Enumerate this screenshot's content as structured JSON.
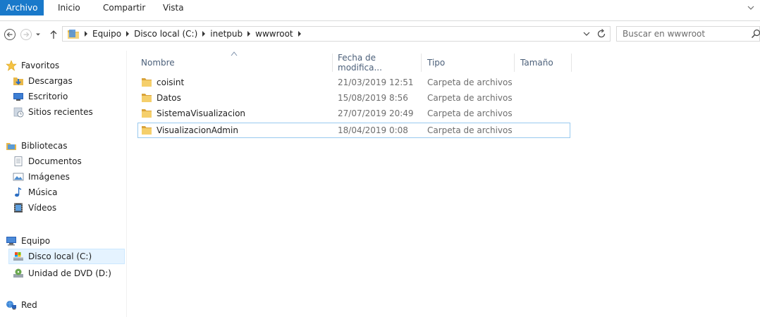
{
  "ribbon": {
    "tabs": [
      "Archivo",
      "Inicio",
      "Compartir",
      "Vista"
    ]
  },
  "address": {
    "crumbs": [
      "Equipo",
      "Disco local (C:)",
      "inetpub",
      "wwwroot"
    ]
  },
  "search": {
    "placeholder": "Buscar en wwwroot"
  },
  "sidebar": {
    "favorites": {
      "label": "Favoritos",
      "items": [
        "Descargas",
        "Escritorio",
        "Sitios recientes"
      ]
    },
    "libraries": {
      "label": "Bibliotecas",
      "items": [
        "Documentos",
        "Imágenes",
        "Música",
        "Vídeos"
      ]
    },
    "computer": {
      "label": "Equipo",
      "items": [
        "Disco local (C:)",
        "Unidad de DVD (D:)"
      ]
    },
    "network": {
      "label": "Red"
    },
    "selected": "Disco local (C:)"
  },
  "columns": [
    "Nombre",
    "Fecha de modifica...",
    "Tipo",
    "Tamaño"
  ],
  "files": [
    {
      "name": "coisint",
      "date": "21/03/2019 12:51",
      "type": "Carpeta de archivos",
      "size": ""
    },
    {
      "name": "Datos",
      "date": "15/08/2019 8:56",
      "type": "Carpeta de archivos",
      "size": ""
    },
    {
      "name": "SistemaVisualizacion",
      "date": "27/07/2019 20:49",
      "type": "Carpeta de archivos",
      "size": ""
    },
    {
      "name": "VisualizacionAdmin",
      "date": "18/04/2019 0:08",
      "type": "Carpeta de archivos",
      "size": ""
    }
  ],
  "colors": {
    "accent": "#1979ca",
    "header_text": "#4c607a",
    "selection_bg": "#e5f3ff",
    "focus_border": "#99c9ef",
    "folder": "#e8b84a"
  },
  "icons": {
    "back": "back-arrow-icon",
    "forward": "forward-arrow-icon",
    "up": "up-arrow-icon",
    "refresh": "refresh-icon",
    "search": "search-icon",
    "folder": "folder-icon"
  }
}
